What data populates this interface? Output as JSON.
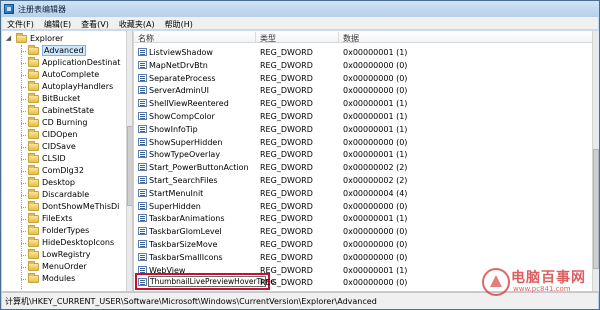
{
  "window": {
    "title": "注册表编辑器",
    "icon": "regedit-icon"
  },
  "menu": [
    "文件(F)",
    "编辑(E)",
    "查看(V)",
    "收藏夹(A)",
    "帮助(H)"
  ],
  "tree": {
    "items": [
      {
        "label": "Explorer",
        "level": 0,
        "expanded": true,
        "selected": false
      },
      {
        "label": "Advanced",
        "level": 1,
        "expanded": false,
        "selected": true
      },
      {
        "label": "ApplicationDestinat",
        "level": 1,
        "expanded": false,
        "selected": false
      },
      {
        "label": "AutoComplete",
        "level": 1,
        "expanded": false,
        "selected": false
      },
      {
        "label": "AutoplayHandlers",
        "level": 1,
        "expanded": false,
        "selected": false
      },
      {
        "label": "BitBucket",
        "level": 1,
        "expanded": false,
        "selected": false
      },
      {
        "label": "CabinetState",
        "level": 1,
        "expanded": false,
        "selected": false
      },
      {
        "label": "CD Burning",
        "level": 1,
        "expanded": false,
        "selected": false
      },
      {
        "label": "CIDOpen",
        "level": 1,
        "expanded": false,
        "selected": false
      },
      {
        "label": "CIDSave",
        "level": 1,
        "expanded": false,
        "selected": false
      },
      {
        "label": "CLSID",
        "level": 1,
        "expanded": false,
        "selected": false
      },
      {
        "label": "ComDlg32",
        "level": 1,
        "expanded": false,
        "selected": false
      },
      {
        "label": "Desktop",
        "level": 1,
        "expanded": false,
        "selected": false
      },
      {
        "label": "Discardable",
        "level": 1,
        "expanded": false,
        "selected": false
      },
      {
        "label": "DontShowMeThisDi",
        "level": 1,
        "expanded": false,
        "selected": false
      },
      {
        "label": "FileExts",
        "level": 1,
        "expanded": false,
        "selected": false
      },
      {
        "label": "FolderTypes",
        "level": 1,
        "expanded": false,
        "selected": false
      },
      {
        "label": "HideDesktopIcons",
        "level": 1,
        "expanded": false,
        "selected": false
      },
      {
        "label": "LowRegistry",
        "level": 1,
        "expanded": false,
        "selected": false
      },
      {
        "label": "MenuOrder",
        "level": 1,
        "expanded": false,
        "selected": false
      },
      {
        "label": "Modules",
        "level": 1,
        "expanded": false,
        "selected": false
      }
    ]
  },
  "list": {
    "headers": {
      "name": "名称",
      "type": "类型",
      "data": "数据"
    },
    "rows": [
      {
        "name": "ListviewShadow",
        "type": "REG_DWORD",
        "data": "0x00000001 (1)"
      },
      {
        "name": "MapNetDrvBtn",
        "type": "REG_DWORD",
        "data": "0x00000000 (0)"
      },
      {
        "name": "SeparateProcess",
        "type": "REG_DWORD",
        "data": "0x00000000 (0)"
      },
      {
        "name": "ServerAdminUI",
        "type": "REG_DWORD",
        "data": "0x00000000 (0)"
      },
      {
        "name": "ShellViewReentered",
        "type": "REG_DWORD",
        "data": "0x00000001 (1)"
      },
      {
        "name": "ShowCompColor",
        "type": "REG_DWORD",
        "data": "0x00000001 (1)"
      },
      {
        "name": "ShowInfoTip",
        "type": "REG_DWORD",
        "data": "0x00000001 (1)"
      },
      {
        "name": "ShowSuperHidden",
        "type": "REG_DWORD",
        "data": "0x00000000 (0)"
      },
      {
        "name": "ShowTypeOverlay",
        "type": "REG_DWORD",
        "data": "0x00000001 (1)"
      },
      {
        "name": "Start_PowerButtonAction",
        "type": "REG_DWORD",
        "data": "0x00000002 (2)"
      },
      {
        "name": "Start_SearchFiles",
        "type": "REG_DWORD",
        "data": "0x00000002 (2)"
      },
      {
        "name": "StartMenuInit",
        "type": "REG_DWORD",
        "data": "0x00000004 (4)"
      },
      {
        "name": "SuperHidden",
        "type": "REG_DWORD",
        "data": "0x00000000 (0)"
      },
      {
        "name": "TaskbarAnimations",
        "type": "REG_DWORD",
        "data": "0x00000001 (1)"
      },
      {
        "name": "TaskbarGlomLevel",
        "type": "REG_DWORD",
        "data": "0x00000000 (0)"
      },
      {
        "name": "TaskbarSizeMove",
        "type": "REG_DWORD",
        "data": "0x00000000 (0)"
      },
      {
        "name": "TaskbarSmallIcons",
        "type": "REG_DWORD",
        "data": "0x00000000 (0)"
      },
      {
        "name": "WebView",
        "type": "REG_DWORD",
        "data": "0x00000001 (1)"
      }
    ],
    "editing_row": {
      "name": "ThumbnailLivePreviewHoverTime",
      "type": "REG_DWORD",
      "data": "0x00000000 (0)"
    }
  },
  "status": {
    "path": "计算机\\HKEY_CURRENT_USER\\Software\\Microsoft\\Windows\\CurrentVersion\\Explorer\\Advanced"
  },
  "watermark": {
    "text": "电脑百事网",
    "url": "www.pc841.com"
  },
  "colors": {
    "highlight_box": "#c8102e",
    "tree_selection": "#cde8ff",
    "title_bar": "#b6d1ea"
  }
}
